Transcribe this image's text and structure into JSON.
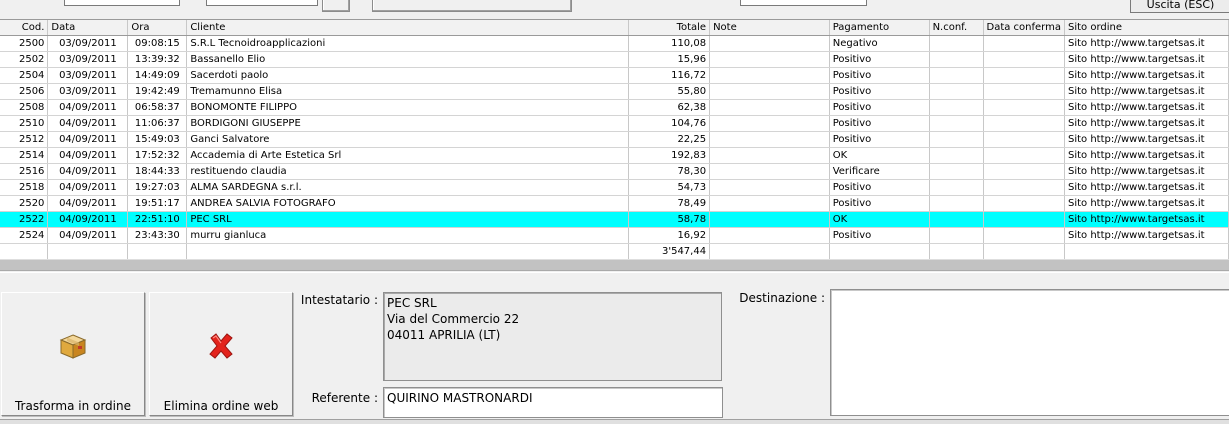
{
  "toolbar": {
    "exit_label": "Uscita (ESC)"
  },
  "grid": {
    "columns": [
      {
        "key": "cod",
        "label": "Cod."
      },
      {
        "key": "data",
        "label": "Data"
      },
      {
        "key": "ora",
        "label": "Ora"
      },
      {
        "key": "cliente",
        "label": "Cliente"
      },
      {
        "key": "totale",
        "label": "Totale"
      },
      {
        "key": "note",
        "label": "Note"
      },
      {
        "key": "pagamento",
        "label": "Pagamento"
      },
      {
        "key": "nconf",
        "label": "N.conf."
      },
      {
        "key": "dataconf",
        "label": "Data conferma"
      },
      {
        "key": "sito",
        "label": "Sito ordine"
      }
    ],
    "rows": [
      {
        "cod": "2500",
        "data": "03/09/2011",
        "ora": "09:08:15",
        "cliente": "S.R.L Tecnoidroapplicazioni",
        "totale": "110,08",
        "note": "",
        "pagamento": "Negativo",
        "nconf": "",
        "dataconf": "",
        "sito": "Sito http://www.targetsas.it"
      },
      {
        "cod": "2502",
        "data": "03/09/2011",
        "ora": "13:39:32",
        "cliente": "Bassanello Elio",
        "totale": "15,96",
        "note": "",
        "pagamento": "Positivo",
        "nconf": "",
        "dataconf": "",
        "sito": "Sito http://www.targetsas.it"
      },
      {
        "cod": "2504",
        "data": "03/09/2011",
        "ora": "14:49:09",
        "cliente": "Sacerdoti paolo",
        "totale": "116,72",
        "note": "",
        "pagamento": "Positivo",
        "nconf": "",
        "dataconf": "",
        "sito": "Sito http://www.targetsas.it"
      },
      {
        "cod": "2506",
        "data": "03/09/2011",
        "ora": "19:42:49",
        "cliente": "Tremamunno Elisa",
        "totale": "55,80",
        "note": "",
        "pagamento": "Positivo",
        "nconf": "",
        "dataconf": "",
        "sito": "Sito http://www.targetsas.it"
      },
      {
        "cod": "2508",
        "data": "04/09/2011",
        "ora": "06:58:37",
        "cliente": "BONOMONTE FILIPPO",
        "totale": "62,38",
        "note": "",
        "pagamento": "Positivo",
        "nconf": "",
        "dataconf": "",
        "sito": "Sito http://www.targetsas.it"
      },
      {
        "cod": "2510",
        "data": "04/09/2011",
        "ora": "11:06:37",
        "cliente": "BORDIGONI GIUSEPPE",
        "totale": "104,76",
        "note": "",
        "pagamento": "Positivo",
        "nconf": "",
        "dataconf": "",
        "sito": "Sito http://www.targetsas.it"
      },
      {
        "cod": "2512",
        "data": "04/09/2011",
        "ora": "15:49:03",
        "cliente": "Ganci Salvatore",
        "totale": "22,25",
        "note": "",
        "pagamento": "Positivo",
        "nconf": "",
        "dataconf": "",
        "sito": "Sito http://www.targetsas.it"
      },
      {
        "cod": "2514",
        "data": "04/09/2011",
        "ora": "17:52:32",
        "cliente": "Accademia di Arte Estetica Srl",
        "totale": "192,83",
        "note": "",
        "pagamento": "OK",
        "nconf": "",
        "dataconf": "",
        "sito": "Sito http://www.targetsas.it"
      },
      {
        "cod": "2516",
        "data": "04/09/2011",
        "ora": "18:44:33",
        "cliente": "restituendo claudia",
        "totale": "78,30",
        "note": "",
        "pagamento": "Verificare",
        "nconf": "",
        "dataconf": "",
        "sito": "Sito http://www.targetsas.it"
      },
      {
        "cod": "2518",
        "data": "04/09/2011",
        "ora": "19:27:03",
        "cliente": "ALMA SARDEGNA s.r.l.",
        "totale": "54,73",
        "note": "",
        "pagamento": "Positivo",
        "nconf": "",
        "dataconf": "",
        "sito": "Sito http://www.targetsas.it"
      },
      {
        "cod": "2520",
        "data": "04/09/2011",
        "ora": "19:51:17",
        "cliente": "ANDREA SALVIA FOTOGRAFO",
        "totale": "78,49",
        "note": "",
        "pagamento": "Positivo",
        "nconf": "",
        "dataconf": "",
        "sito": "Sito http://www.targetsas.it"
      },
      {
        "cod": "2522",
        "data": "04/09/2011",
        "ora": "22:51:10",
        "cliente": "PEC SRL",
        "totale": "58,78",
        "note": "",
        "pagamento": "OK",
        "nconf": "",
        "dataconf": "",
        "sito": "Sito http://www.targetsas.it",
        "selected": true
      },
      {
        "cod": "2524",
        "data": "04/09/2011",
        "ora": "23:43:30",
        "cliente": "murru gianluca",
        "totale": "16,92",
        "note": "",
        "pagamento": "Positivo",
        "nconf": "",
        "dataconf": "",
        "sito": "Sito http://www.targetsas.it"
      }
    ],
    "total": "3'547,44"
  },
  "actions": {
    "convert_label": "Trasforma in ordine",
    "delete_label": "Elimina ordine web"
  },
  "details": {
    "intestatario_label": "Intestatario :",
    "intestatario_lines": [
      "PEC SRL",
      "Via del Commercio 22",
      "04011 APRILIA (LT)"
    ],
    "referente_label": "Referente :",
    "referente_value": "QUIRINO MASTRONARDI",
    "destinazione_label": "Destinazione :",
    "destinazione_value": ""
  },
  "colors": {
    "selection": "#00ffff"
  }
}
